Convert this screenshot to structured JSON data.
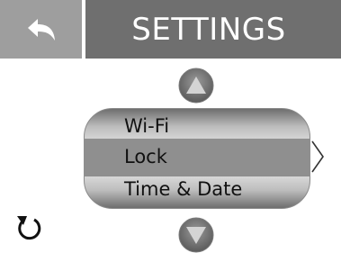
{
  "header": {
    "title": "SETTINGS",
    "back_icon": "back-arrow-icon"
  },
  "list": {
    "items": [
      {
        "label": "Wi-Fi",
        "selected": false
      },
      {
        "label": "Lock",
        "selected": true
      },
      {
        "label": "Time & Date",
        "selected": false
      }
    ]
  },
  "icons": {
    "scroll_up": "triangle-up-icon",
    "scroll_down": "triangle-down-icon",
    "next": "chevron-right-icon",
    "refresh": "refresh-icon"
  },
  "colors": {
    "title_bar": "#6f6f6f",
    "back_tile": "#9e9e9e",
    "selected_row": "#8f8f8f"
  }
}
